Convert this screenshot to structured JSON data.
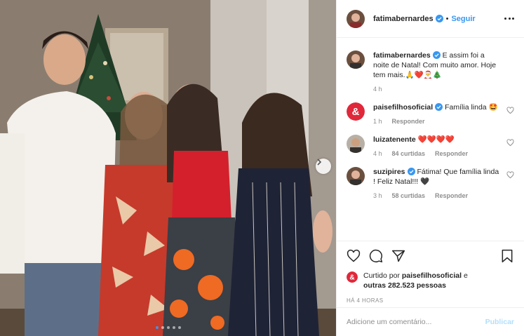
{
  "post": {
    "username": "fatimabernardes",
    "separator": "•",
    "follow_label": "Seguir",
    "carousel": {
      "slide_count": 5,
      "active_index": 0
    }
  },
  "comments": [
    {
      "username": "fatimabernardes",
      "verified": true,
      "text": "E assim foi a noite de Natal! Com muito amor. Hoje tem mais.🙏❤️🎅🎄",
      "time": "4 h",
      "likes": "",
      "reply": "",
      "avatar": "portrait-avatar"
    },
    {
      "username": "paisefilhosoficial",
      "verified": true,
      "text": "Família linda 🤩",
      "time": "1 h",
      "likes": "",
      "reply": "Responder",
      "avatar": "ampersand-logo-avatar"
    },
    {
      "username": "luizatenente",
      "verified": false,
      "text": "❤️❤️❤️❤️",
      "time": "4 h",
      "likes": "84 curtidas",
      "reply": "Responder",
      "avatar": "portrait-avatar"
    },
    {
      "username": "suzipires",
      "verified": true,
      "text": "Fátima! Que família linda ! Feliz Natal!!! 🖤",
      "time": "3 h",
      "likes": "58 curtidas",
      "reply": "Responder",
      "avatar": "portrait-avatar"
    }
  ],
  "likes": {
    "prefix": "Curtido por ",
    "user": "paisefilhosoficial",
    "middle": " e ",
    "others": "outras 282.523 pessoas"
  },
  "timestamp": "HÁ 4 HORAS",
  "comment_box": {
    "placeholder": "Adicione um comentário...",
    "post_label": "Publicar"
  },
  "colors": {
    "accent_blue": "#3897f0",
    "brand_red": "#e0283a",
    "text": "#262626",
    "muted": "#8e8e8e"
  }
}
